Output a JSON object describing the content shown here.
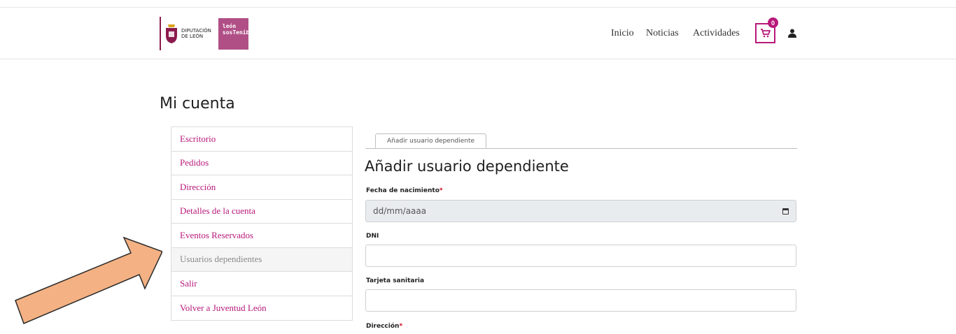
{
  "header": {
    "logo_diputacion": "DIPUTACIÓN DE LEÓN",
    "logo_leon_sostenible": "león sosTenible",
    "nav": [
      "Inicio",
      "Noticias",
      "Actividades"
    ],
    "cart_count": "0",
    "accent_color": "#b8197a"
  },
  "page_title": "Mi cuenta",
  "sidebar": {
    "items": [
      {
        "label": "Escritorio"
      },
      {
        "label": "Pedidos"
      },
      {
        "label": "Dirección"
      },
      {
        "label": "Detalles de la cuenta"
      },
      {
        "label": "Eventos Reservados"
      },
      {
        "label": "Usuarios dependientes",
        "active": true
      },
      {
        "label": "Salir"
      },
      {
        "label": "Volver a Juventud León"
      }
    ]
  },
  "tab": {
    "label": "Añadir usuario dependiente"
  },
  "form": {
    "title": "Añadir usuario dependiente",
    "birth_label": "Fecha de nacimiento",
    "birth_placeholder": "dd/mm/aaaa",
    "dni_label": "DNI",
    "dni_value": "",
    "card_label": "Tarjeta sanitaria",
    "card_value": "",
    "address_label": "Dirección",
    "required_mark": "*"
  },
  "annotation": {
    "icon": "orange-arrow",
    "color": "#f4b183"
  }
}
